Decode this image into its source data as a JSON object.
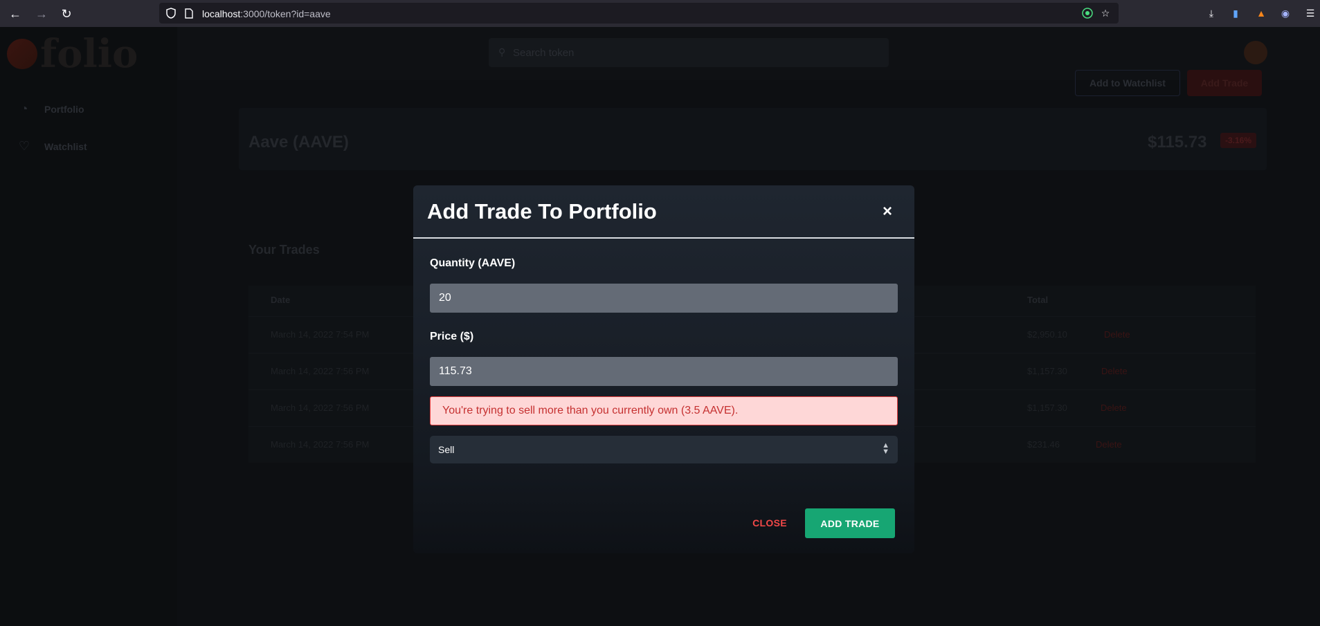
{
  "browser": {
    "url_host": "localhost",
    "url_rest": ":3000/token?id=aave"
  },
  "app": {
    "logo_text": "folio",
    "search_placeholder": "Search token",
    "sidebar": [
      {
        "label": "Portfolio",
        "icon": "pie-chart-icon"
      },
      {
        "label": "Watchlist",
        "icon": "heart-icon"
      }
    ],
    "buttons": {
      "add_to_watchlist": "Add to Watchlist",
      "add_trade": "Add Trade"
    },
    "token": {
      "name": "Aave (AAVE)",
      "price": "$115.73",
      "change": "-3.16%"
    },
    "trades": {
      "title": "Your Trades",
      "columns": [
        "Date",
        "Total"
      ],
      "rows": [
        {
          "date": "March 14, 2022 7:54 PM",
          "total": "$2,950.10",
          "action": "Delete"
        },
        {
          "date": "March 14, 2022 7:56 PM",
          "total": "$1,157.30",
          "action": "Delete"
        },
        {
          "date": "March 14, 2022 7:56 PM",
          "total": "$1,157.30",
          "action": "Delete"
        },
        {
          "date": "March 14, 2022 7:56 PM",
          "total": "$231.46",
          "action": "Delete"
        }
      ]
    }
  },
  "modal": {
    "title": "Add Trade To Portfolio",
    "close_symbol": "×",
    "quantity_label": "Quantity (AAVE)",
    "quantity_value": "20",
    "price_label": "Price ($)",
    "price_value": "115.73",
    "error": "You're trying to sell more than you currently own (3.5 AAVE).",
    "type_selected": "Sell",
    "close_button": "CLOSE",
    "submit_button": "ADD TRADE"
  },
  "colors": {
    "accent_green": "#17a673",
    "danger_red": "#f24848",
    "error_bg": "#fed7d7"
  }
}
